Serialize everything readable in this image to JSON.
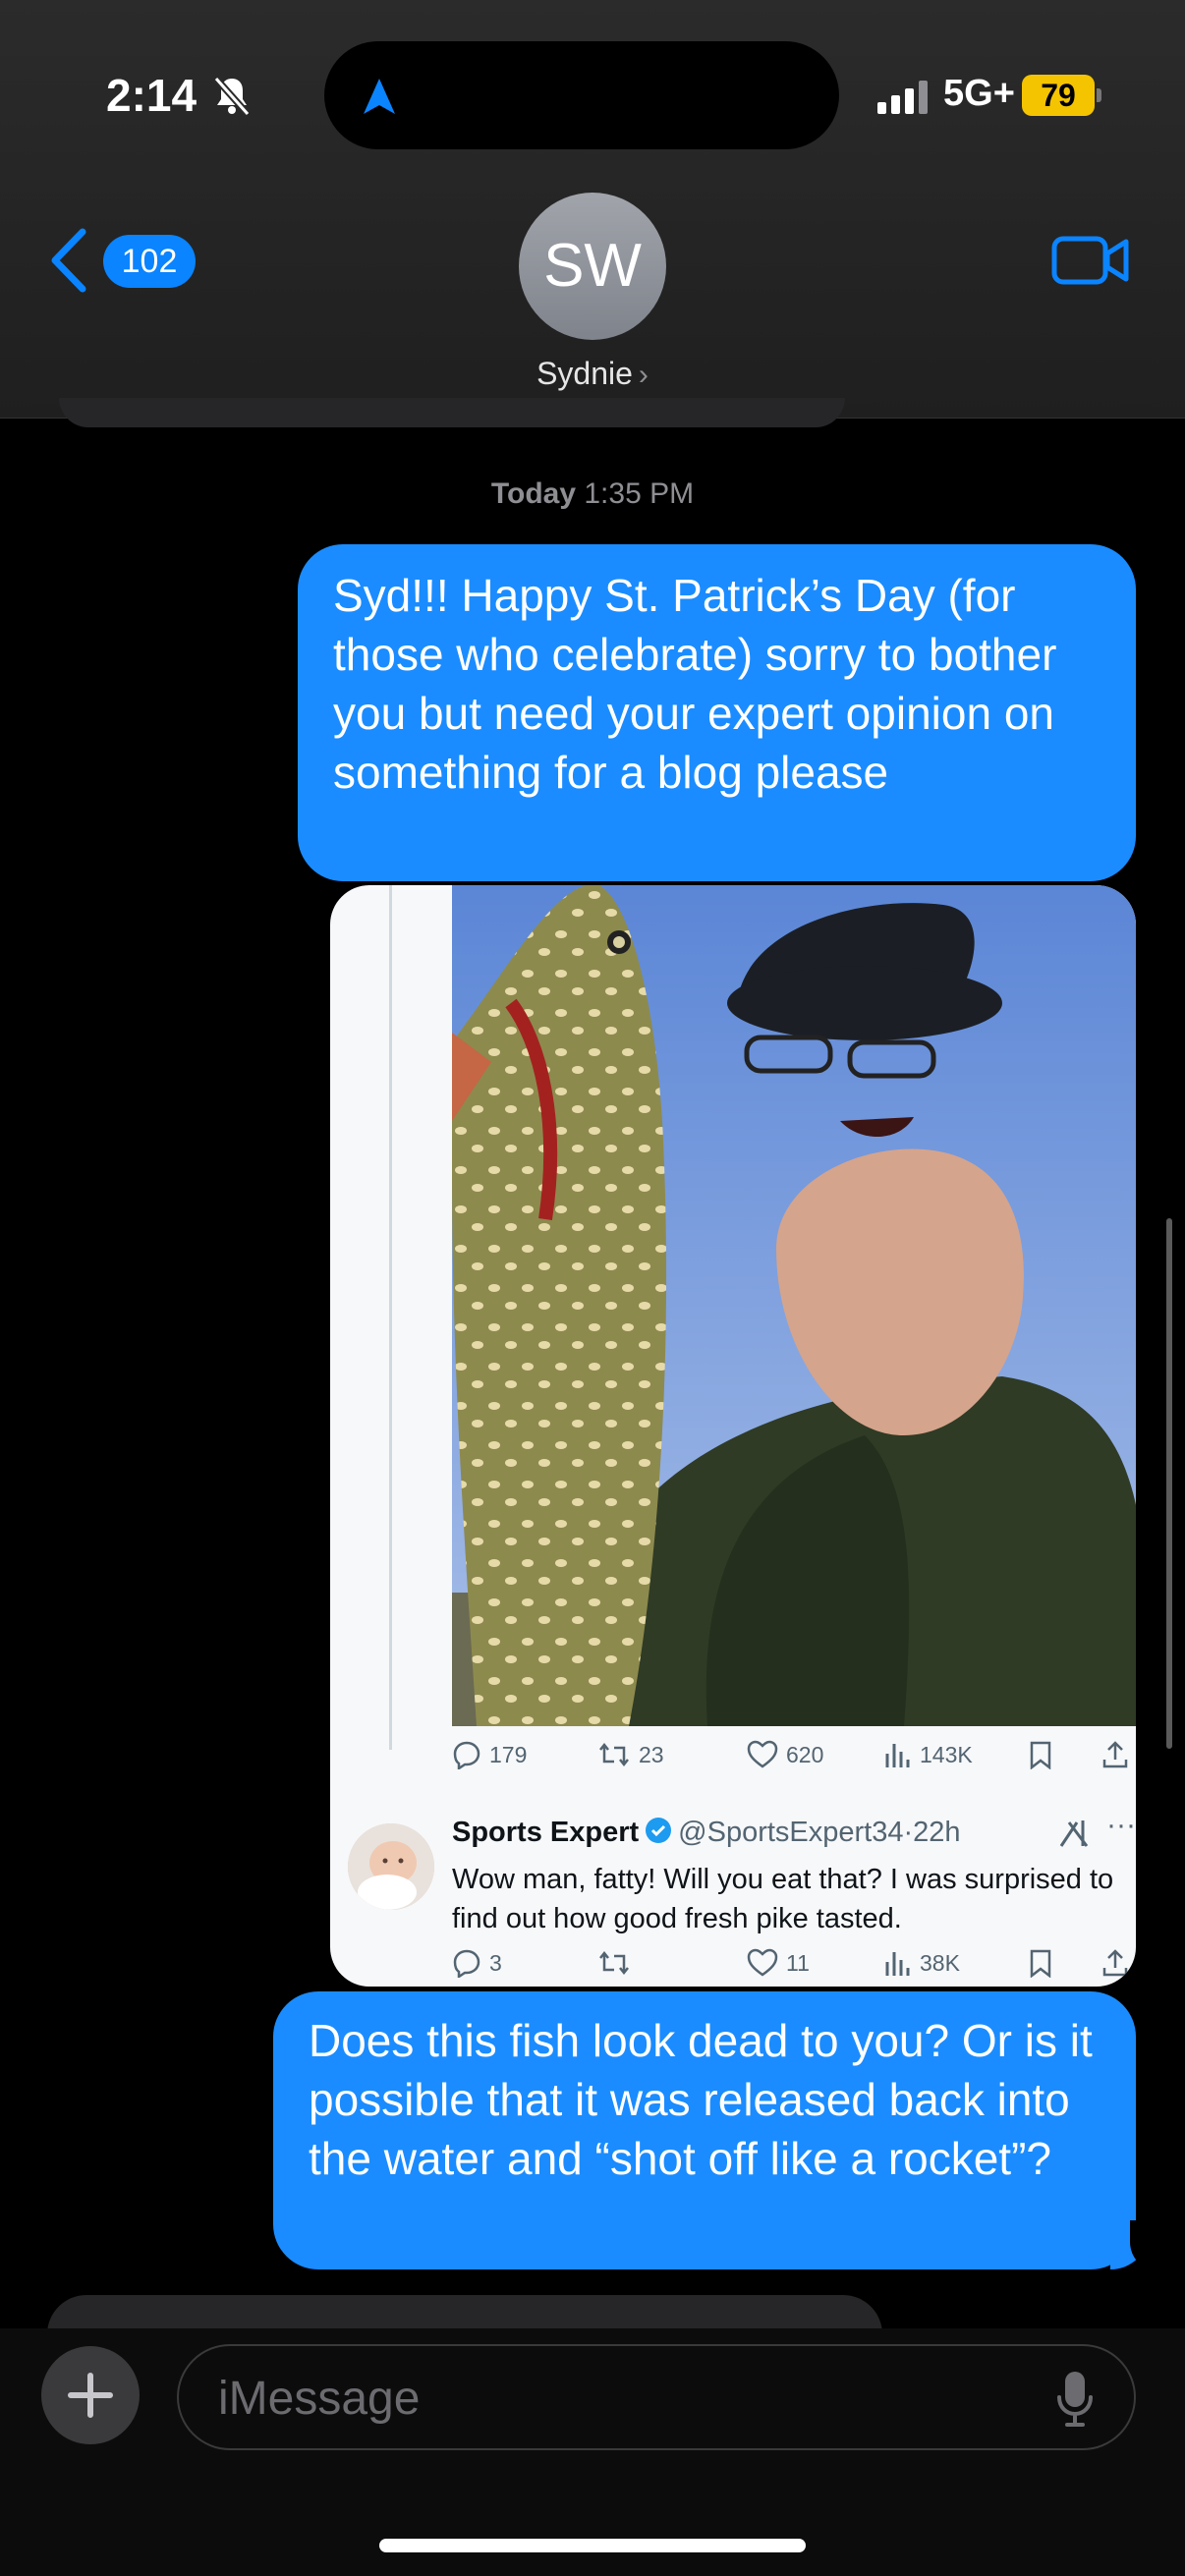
{
  "status_bar": {
    "time": "2:14",
    "network": "5G+",
    "battery": "79"
  },
  "header": {
    "back_count": "102",
    "avatar_initials": "SW",
    "contact_name": "Sydnie",
    "chevron": "›"
  },
  "conversation": {
    "timestamp_day": "Today",
    "timestamp_time": "1:35 PM",
    "messages": [
      {
        "text": "Syd!!! Happy St. Patrick’s Day (for those who celebrate) sorry to bother you but need your expert opinion on something for a blog please"
      },
      {
        "text": "Does this fish look dead to you? Or is it possible that it was released back into the water and “shot off like a rocket”?"
      }
    ]
  },
  "tweet": {
    "stats": {
      "replies": "179",
      "retweets": "23",
      "likes": "620",
      "views": "143K"
    },
    "reply": {
      "name": "Sports Expert",
      "handle": "@SportsExpert34",
      "dot": "·",
      "time": "22h",
      "text": "Wow man, fatty! Will you eat that? I was surprised to find out how good fresh pike tasted.",
      "stats": {
        "replies": "3",
        "retweets": "",
        "likes": "11",
        "views": "38K"
      }
    }
  },
  "composer": {
    "placeholder": "iMessage"
  },
  "colors": {
    "bubble": "#1a8cff",
    "accent": "#0a84ff",
    "battery": "#f5c400"
  },
  "icons": [
    "bell-slash-icon",
    "location-arrow-icon",
    "signal-icon",
    "back-chevron-icon",
    "video-icon",
    "reply-icon",
    "retweet-icon",
    "like-icon",
    "views-icon",
    "bookmark-icon",
    "share-icon",
    "verified-icon",
    "x-grok-icon",
    "plus-icon",
    "mic-icon"
  ]
}
